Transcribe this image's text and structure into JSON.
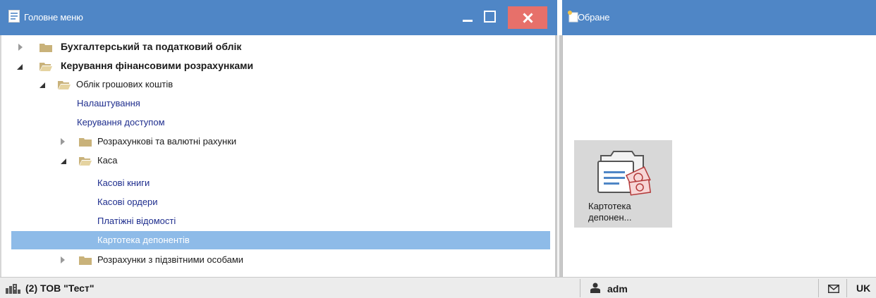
{
  "main_menu": {
    "title": "Головне меню",
    "controls": [
      "minimize",
      "maximize",
      "close"
    ]
  },
  "favorites": {
    "title": "Обране",
    "tile": {
      "line1": "Картотека",
      "line2": "депонен...",
      "icon": "card-index-cash-icon"
    }
  },
  "tree": [
    {
      "label": "Бухгалтерський та податковий облік",
      "level": 0,
      "kind": "folder",
      "expanded": false,
      "bold": true
    },
    {
      "label": "Керування фінансовими розрахунками",
      "level": 0,
      "kind": "folder",
      "expanded": true,
      "bold": true
    },
    {
      "label": "Облік грошових коштів",
      "level": 1,
      "kind": "folder",
      "expanded": true
    },
    {
      "label": "Налаштування",
      "level": 2,
      "kind": "item"
    },
    {
      "label": "Керування доступом",
      "level": 2,
      "kind": "item"
    },
    {
      "label": "Розрахункові та валютні рахунки",
      "level": 2,
      "kind": "folder",
      "expanded": false
    },
    {
      "label": "Каса",
      "level": 2,
      "kind": "folder",
      "expanded": true
    },
    {
      "label": "Касові книги",
      "level": 3,
      "kind": "item"
    },
    {
      "label": "Касові ордери",
      "level": 3,
      "kind": "item"
    },
    {
      "label": "Платіжні відомості",
      "level": 3,
      "kind": "item"
    },
    {
      "label": "Картотека депонентів",
      "level": 3,
      "kind": "item",
      "selected": true
    },
    {
      "label": "Розрахунки з підзвітними особами",
      "level": 2,
      "kind": "folder",
      "expanded": false
    }
  ],
  "status": {
    "organization": "(2) ТОВ \"Тест\"",
    "user": "adm",
    "language": "UK"
  },
  "colors": {
    "titlebar": "#4f86c6",
    "close_button": "#e7706a",
    "selection": "#8ebbe8",
    "link_text": "#1f2e8e",
    "folder": "#c9b27a"
  }
}
